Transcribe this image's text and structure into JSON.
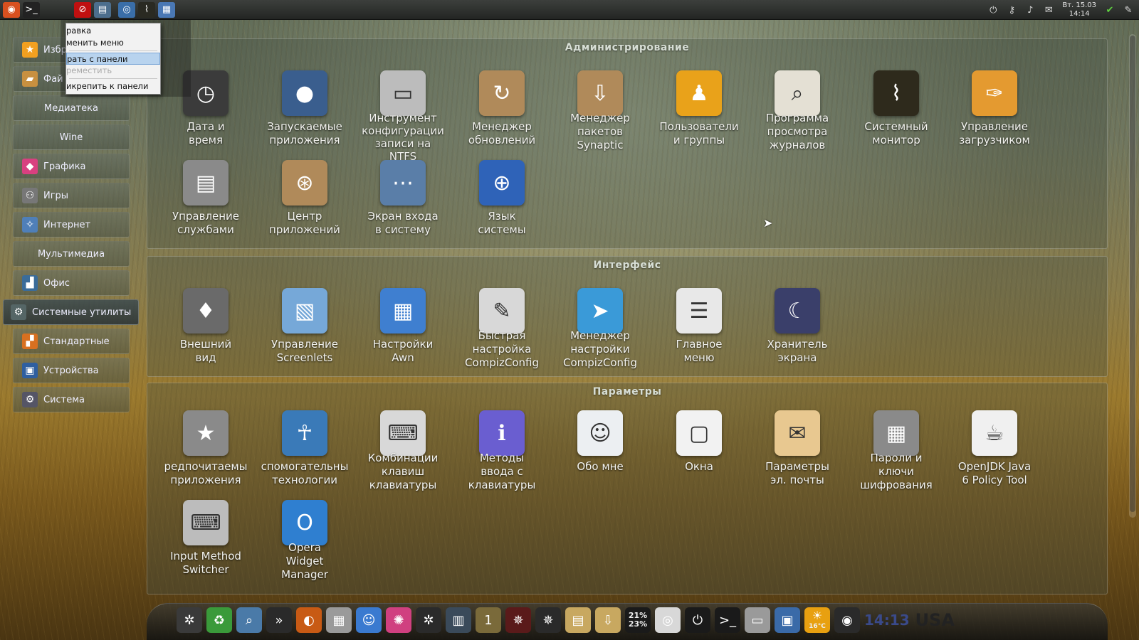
{
  "top_panel": {
    "launchers": [
      {
        "name": "ubuntu-logo-icon",
        "glyph": "◉",
        "color": "#d8501f"
      },
      {
        "name": "terminal-icon",
        "glyph": ">_",
        "color": "#222"
      },
      {
        "name": "stop-icon",
        "glyph": "⊘",
        "color": "#c01010"
      },
      {
        "name": "menu-applet-icon",
        "glyph": "▤",
        "color": "#4c6e8d"
      },
      {
        "name": "browser-icon",
        "glyph": "◎",
        "color": "#3a6ea8"
      },
      {
        "name": "system-monitor-icon",
        "glyph": "⌇",
        "color": "#2a2a22"
      },
      {
        "name": "desktop-icon",
        "glyph": "▦",
        "color": "#4a78b4"
      }
    ],
    "clock": {
      "date": "Вт. 15.03",
      "time": "14:14"
    },
    "tray": [
      {
        "name": "power-icon",
        "glyph": "⏻"
      },
      {
        "name": "key-icon",
        "glyph": "⚷"
      },
      {
        "name": "volume-icon",
        "glyph": "♪"
      },
      {
        "name": "mail-icon",
        "glyph": "✉"
      },
      {
        "name": "update-shield-icon",
        "glyph": "✔"
      },
      {
        "name": "edit-icon",
        "glyph": "✎"
      }
    ]
  },
  "context_menu": {
    "items": [
      {
        "label": "равка",
        "state": "normal"
      },
      {
        "label": "менить меню",
        "state": "normal"
      },
      {
        "label": "рать с панели",
        "state": "selected"
      },
      {
        "label": "реместить",
        "state": "disabled"
      },
      {
        "label": "икрепить к панели",
        "state": "normal"
      }
    ]
  },
  "sidebar": {
    "items": [
      {
        "label": "Избр",
        "icon": "star-icon",
        "glyph": "★",
        "color": "#f2a020",
        "active": false
      },
      {
        "label": "Фай",
        "icon": "folder-icon",
        "glyph": "▰",
        "color": "#c89040",
        "active": false
      },
      {
        "label": "Медиатека",
        "icon": "",
        "glyph": "",
        "color": "",
        "active": false
      },
      {
        "label": "Wine",
        "icon": "",
        "glyph": "",
        "color": "",
        "active": false
      },
      {
        "label": "Графика",
        "icon": "graphics-icon",
        "glyph": "◆",
        "color": "#d84080",
        "active": false
      },
      {
        "label": "Игры",
        "icon": "gamepad-icon",
        "glyph": "⚇",
        "color": "#777",
        "active": false
      },
      {
        "label": "Интернет",
        "icon": "internet-icon",
        "glyph": "✧",
        "color": "#4f7fb8",
        "active": false
      },
      {
        "label": "Мультимедиа",
        "icon": "",
        "glyph": "",
        "color": "",
        "active": false
      },
      {
        "label": "Офис",
        "icon": "office-icon",
        "glyph": "▟",
        "color": "#3a6c9a",
        "active": false
      },
      {
        "label": "Системные утилиты",
        "icon": "system-tools-icon",
        "glyph": "⚙",
        "color": "#566",
        "active": true
      },
      {
        "label": "Стандартные",
        "icon": "accessories-icon",
        "glyph": "▞",
        "color": "#d87020",
        "active": false
      },
      {
        "label": "Устройства",
        "icon": "devices-icon",
        "glyph": "▣",
        "color": "#2f5fa0",
        "active": false
      },
      {
        "label": "Система",
        "icon": "system-icon",
        "glyph": "⚙",
        "color": "#556",
        "active": false
      }
    ]
  },
  "sections": [
    {
      "title": "Администрирование",
      "apps": [
        {
          "label": "Дата и\nвремя",
          "icon": "calendar-clock-icon",
          "glyph": "◷",
          "color": "#3b3b3b"
        },
        {
          "label": "Запускаемые\nприложения",
          "icon": "user-silhouette-icon",
          "glyph": "●",
          "color": "#3a5e8e"
        },
        {
          "label": "Инструмент\nконфигурации\nзаписи на\nNTFS",
          "icon": "disk-drive-icon",
          "glyph": "▭",
          "color": "#bcbcbc"
        },
        {
          "label": "Менеджер\nобновлений",
          "icon": "package-update-icon",
          "glyph": "↻",
          "color": "#b08a5a"
        },
        {
          "label": "Менеджер\nпакетов\nSynaptic",
          "icon": "package-download-icon",
          "glyph": "⇩",
          "color": "#b08a5a"
        },
        {
          "label": "Пользователи\nи группы",
          "icon": "users-icon",
          "glyph": "♟",
          "color": "#e9a21a"
        },
        {
          "label": "Программа\nпросмотра\nжурналов",
          "icon": "log-viewer-icon",
          "glyph": "⌕",
          "color": "#e4e0d4"
        },
        {
          "label": "Системный\nмонитор",
          "icon": "system-monitor-icon",
          "glyph": "⌇",
          "color": "#2e2a1c"
        },
        {
          "label": "Управление\nзагрузчиком",
          "icon": "wrench-icon",
          "glyph": "✑",
          "color": "#e49a30"
        },
        {
          "label": "Управление\nслужбами",
          "icon": "services-computer-icon",
          "glyph": "▤",
          "color": "#8a8a8a"
        },
        {
          "label": "Центр\nприложений",
          "icon": "software-center-icon",
          "glyph": "⊛",
          "color": "#b08a5a"
        },
        {
          "label": "Экран входа\nв систему",
          "icon": "login-screen-icon",
          "glyph": "⋯",
          "color": "#5a7ea8"
        },
        {
          "label": "Язык\nсистемы",
          "icon": "language-globe-icon",
          "glyph": "⊕",
          "color": "#2f63b8"
        }
      ]
    },
    {
      "title": "Интерфейс",
      "apps": [
        {
          "label": "Внешний\nвид",
          "icon": "appearance-suit-icon",
          "glyph": "♦",
          "color": "#6a6a6a"
        },
        {
          "label": "Управление\nScreenlets",
          "icon": "screenlets-icon",
          "glyph": "▧",
          "color": "#76a8d8"
        },
        {
          "label": "Настройки\nAwn",
          "icon": "awn-dock-icon",
          "glyph": "▦",
          "color": "#3f7fd0"
        },
        {
          "label": "Быстрая\nнастройка\nCompizConfig",
          "icon": "compiz-simple-icon",
          "glyph": "✎",
          "color": "#d8d8d8"
        },
        {
          "label": "Менеджер\nнастройки\nCompizConfig",
          "icon": "compiz-manager-icon",
          "glyph": "➤",
          "color": "#3a9ad8"
        },
        {
          "label": "Главное\nменю",
          "icon": "main-menu-icon",
          "glyph": "☰",
          "color": "#e8e8e8"
        },
        {
          "label": "Хранитель\nэкрана",
          "icon": "screensaver-moon-icon",
          "glyph": "☾",
          "color": "#3a3f6a"
        }
      ]
    },
    {
      "title": "Параметры",
      "apps": [
        {
          "label": "редпочитаемы\nприложения",
          "icon": "preferred-apps-star-icon",
          "glyph": "★",
          "color": "#8a8a8a"
        },
        {
          "label": "спомогательны\nтехнологии",
          "icon": "accessibility-icon",
          "glyph": "☥",
          "color": "#3a7ab8"
        },
        {
          "label": "Комбинации\nклавиш\nклавиатуры",
          "icon": "keyboard-shortcuts-icon",
          "glyph": "⌨",
          "color": "#d8d8d8"
        },
        {
          "label": "Методы\nввода с\nклавиатуры",
          "icon": "info-icon",
          "glyph": "ℹ",
          "color": "#6a5ed0"
        },
        {
          "label": "Обо мне",
          "icon": "about-me-card-icon",
          "glyph": "☺",
          "color": "#eceff2"
        },
        {
          "label": "Окна",
          "icon": "windows-icon",
          "glyph": "▢",
          "color": "#f2f2f2"
        },
        {
          "label": "Параметры\nэл. почты",
          "icon": "mail-settings-icon",
          "glyph": "✉",
          "color": "#e8c890"
        },
        {
          "label": "Пароли и\nключи\nшифрования",
          "icon": "safe-icon",
          "glyph": "▦",
          "color": "#8a8a8a"
        },
        {
          "label": "OpenJDK Java\n6 Policy Tool",
          "icon": "java-icon",
          "glyph": "☕",
          "color": "#f0f0f0"
        },
        {
          "label": "Input Method\nSwitcher",
          "icon": "input-method-keyboard-icon",
          "glyph": "⌨",
          "color": "#bcbcbc"
        },
        {
          "label": "Opera\nWidget\nManager",
          "icon": "opera-widget-icon",
          "glyph": "O",
          "color": "#2f7fd0"
        }
      ]
    }
  ],
  "dock": {
    "items": [
      {
        "name": "settings-gear-icon",
        "glyph": "✲",
        "color": "#3a3a3a"
      },
      {
        "name": "recycle-icon",
        "glyph": "♻",
        "color": "#3a9a3a"
      },
      {
        "name": "search-magnifier-icon",
        "glyph": "⌕",
        "color": "#4a7aa8"
      },
      {
        "name": "terminal-arrow-icon",
        "glyph": "»",
        "color": "#2a2a2a"
      },
      {
        "name": "firefox-icon",
        "glyph": "◐",
        "color": "#c85a14"
      },
      {
        "name": "calculator-icon",
        "glyph": "▦",
        "color": "#9a9a9a"
      },
      {
        "name": "finder-face-icon",
        "glyph": "☺",
        "color": "#3a7ad0"
      },
      {
        "name": "color-wheel-icon",
        "glyph": "✺",
        "color": "#d04080"
      },
      {
        "name": "aperture-icon",
        "glyph": "✲",
        "color": "#2a2a2a"
      },
      {
        "name": "window-manager-icon",
        "glyph": "▥",
        "color": "#3a4a5a"
      },
      {
        "name": "workspace-switcher-icon",
        "glyph": "1",
        "color": "#7a6a3a"
      },
      {
        "name": "red-spider-icon",
        "glyph": "✵",
        "color": "#5a1a1a"
      },
      {
        "name": "dark-spider-icon",
        "glyph": "✵",
        "color": "#2a2a2a"
      },
      {
        "name": "notes-icon",
        "glyph": "▤",
        "color": "#c8a860"
      },
      {
        "name": "download-folder-icon",
        "glyph": "⇩",
        "color": "#c8a860"
      },
      {
        "name": "cpu-meter-icon",
        "glyph": "",
        "color": "#1a1a1a"
      },
      {
        "name": "cd-disc-icon",
        "glyph": "◎",
        "color": "#d8d8d8"
      },
      {
        "name": "power-button-icon",
        "glyph": "⏻",
        "color": "#1a1a1a"
      },
      {
        "name": "console-icon",
        "glyph": ">_",
        "color": "#1a1a1a"
      },
      {
        "name": "printer-icon",
        "glyph": "▭",
        "color": "#9a9a9a"
      },
      {
        "name": "package-box-icon",
        "glyph": "▣",
        "color": "#3a6aa8"
      },
      {
        "name": "weather-sun-icon",
        "glyph": "☀",
        "color": "#e8a010"
      },
      {
        "name": "speaker-icon",
        "glyph": "◉",
        "color": "#2a2a2a"
      }
    ],
    "cpu_top": "21%",
    "cpu_bottom": "23%",
    "weather_temp": "16°C",
    "clock": "14:13",
    "country": "USA"
  }
}
